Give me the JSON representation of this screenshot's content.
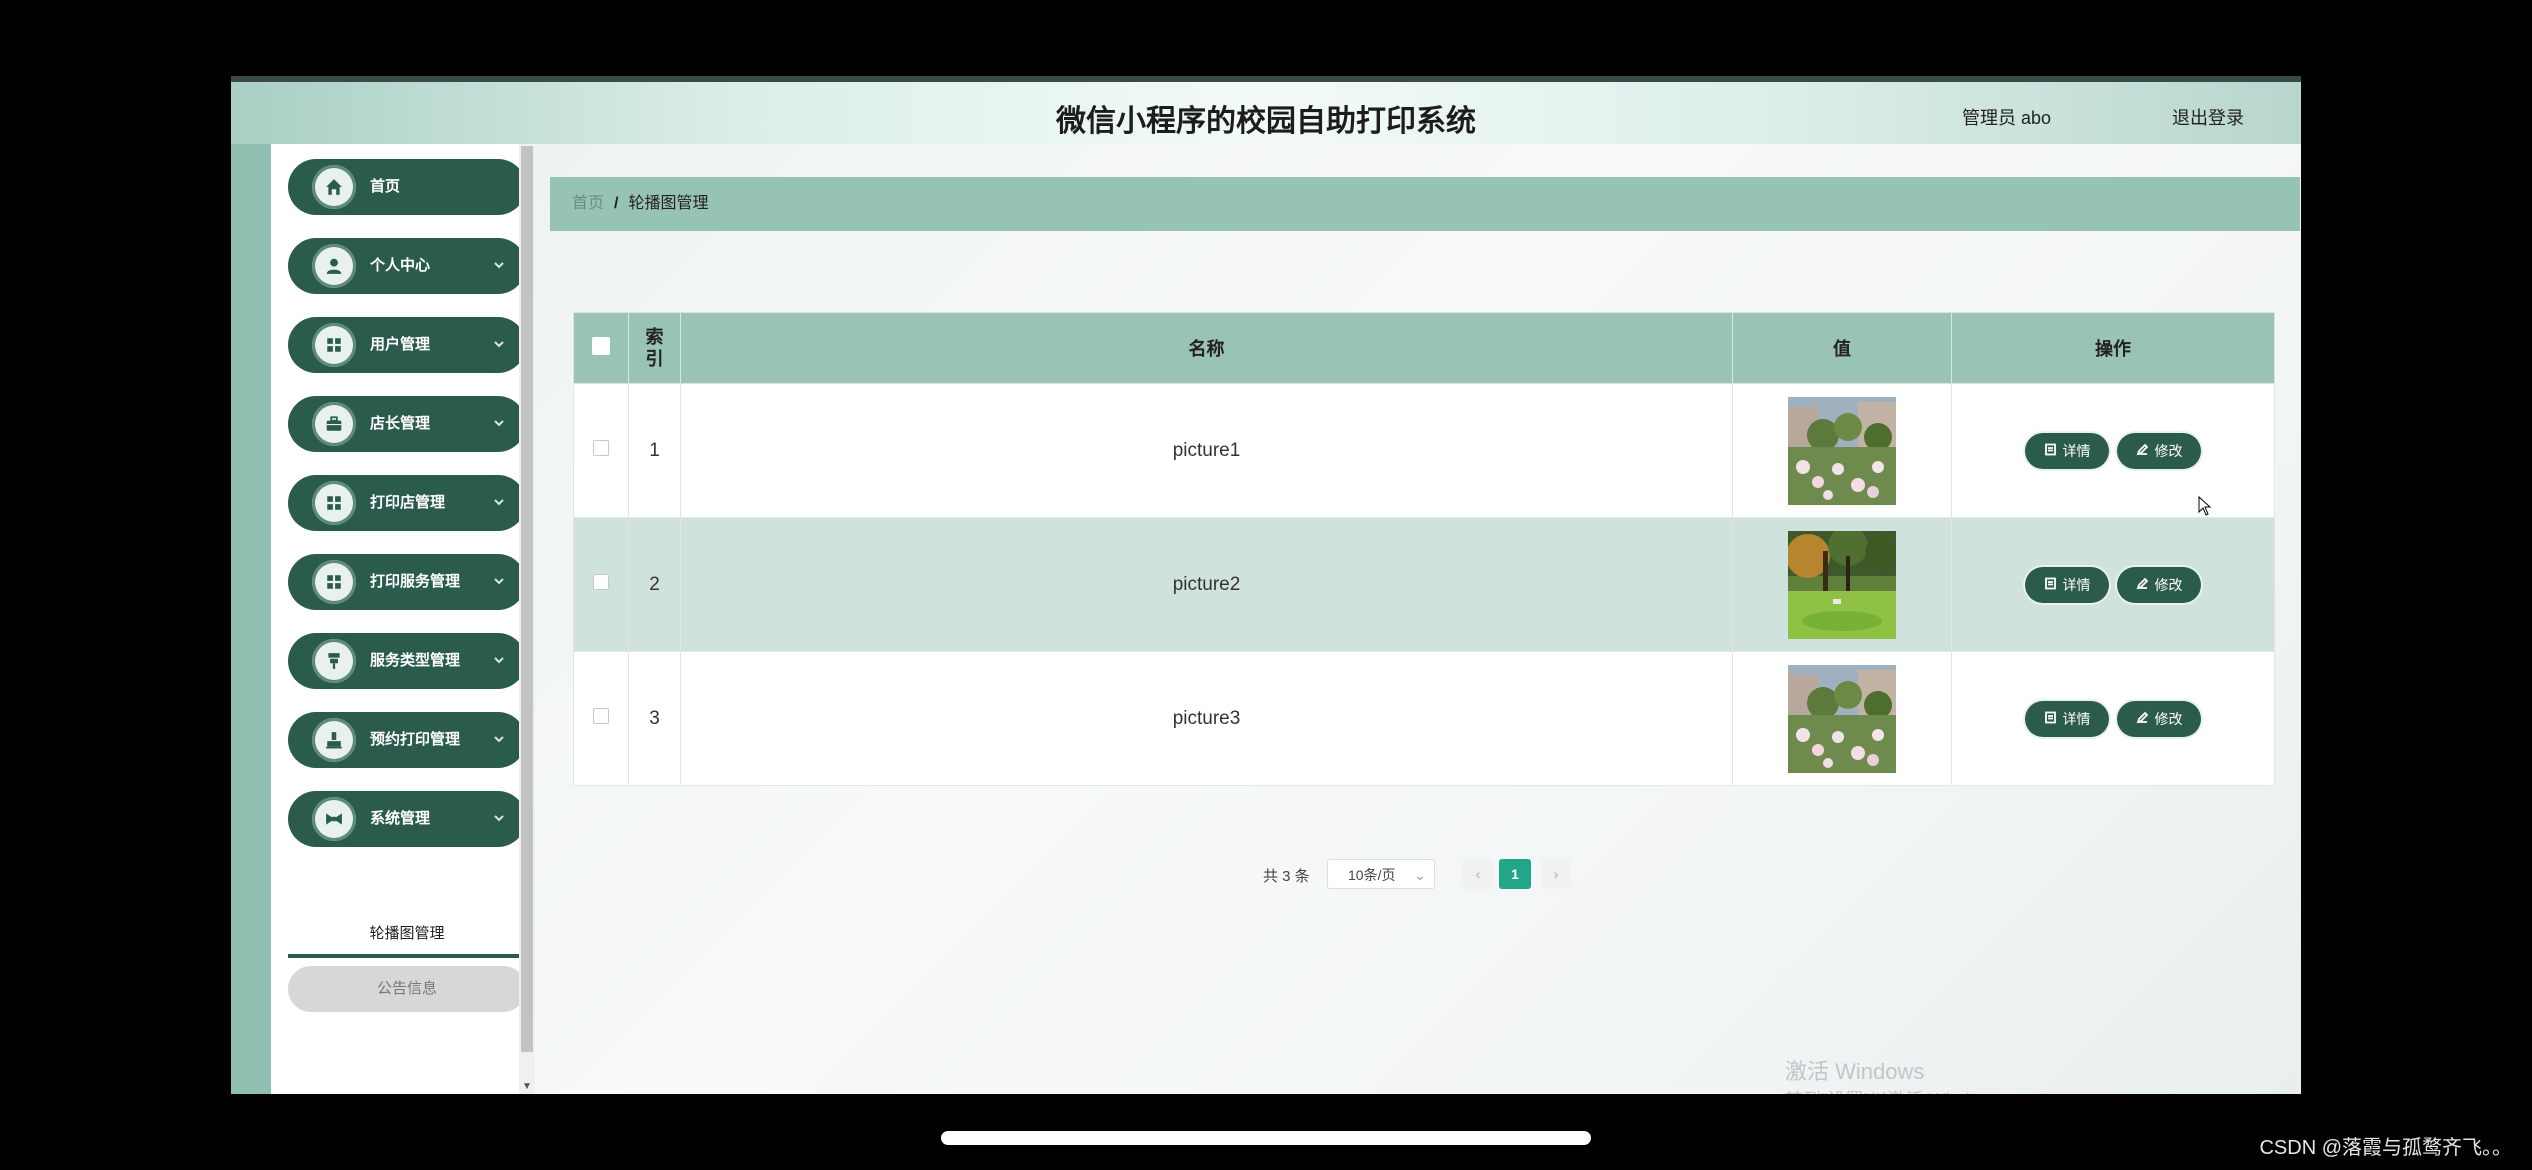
{
  "header": {
    "title": "微信小程序的校园自助打印系统",
    "user": "管理员 abo",
    "logout": "退出登录"
  },
  "sidebar": {
    "items": [
      {
        "label": "首页",
        "icon": "home-icon",
        "has_chevron": false
      },
      {
        "label": "个人中心",
        "icon": "user-icon",
        "has_chevron": true
      },
      {
        "label": "用户管理",
        "icon": "grid-icon",
        "has_chevron": true
      },
      {
        "label": "店长管理",
        "icon": "briefcase-icon",
        "has_chevron": true
      },
      {
        "label": "打印店管理",
        "icon": "grid-icon",
        "has_chevron": true
      },
      {
        "label": "打印服务管理",
        "icon": "grid-icon",
        "has_chevron": true
      },
      {
        "label": "服务类型管理",
        "icon": "pin-icon",
        "has_chevron": true
      },
      {
        "label": "预约打印管理",
        "icon": "stamp-icon",
        "has_chevron": true
      },
      {
        "label": "系统管理",
        "icon": "bowtie-icon",
        "has_chevron": true
      }
    ],
    "submenu": {
      "active": "轮播图管理",
      "other": "公告信息"
    }
  },
  "breadcrumb": {
    "home": "首页",
    "separator": "/",
    "current": "轮播图管理"
  },
  "table": {
    "headers": {
      "index": "索引",
      "name": "名称",
      "value": "值",
      "actions": "操作"
    },
    "rows": [
      {
        "index": "1",
        "name": "picture1",
        "image": "garden-flowers"
      },
      {
        "index": "2",
        "name": "picture2",
        "image": "park-lawn"
      },
      {
        "index": "3",
        "name": "picture3",
        "image": "garden-flowers"
      }
    ],
    "detail_label": "详情",
    "edit_label": "修改"
  },
  "pagination": {
    "total": "共 3 条",
    "page_size": "10条/页",
    "current_page": "1"
  },
  "watermark": {
    "line1": "激活 Windows",
    "line2": "转到\"设置\"以激活 Windows。"
  },
  "footer": {
    "credit": "CSDN @落霞与孤鹜齐飞。。"
  },
  "colors": {
    "primary": "#2a5b4c",
    "header_bg": "#98c3b6",
    "accent": "#22a688"
  }
}
